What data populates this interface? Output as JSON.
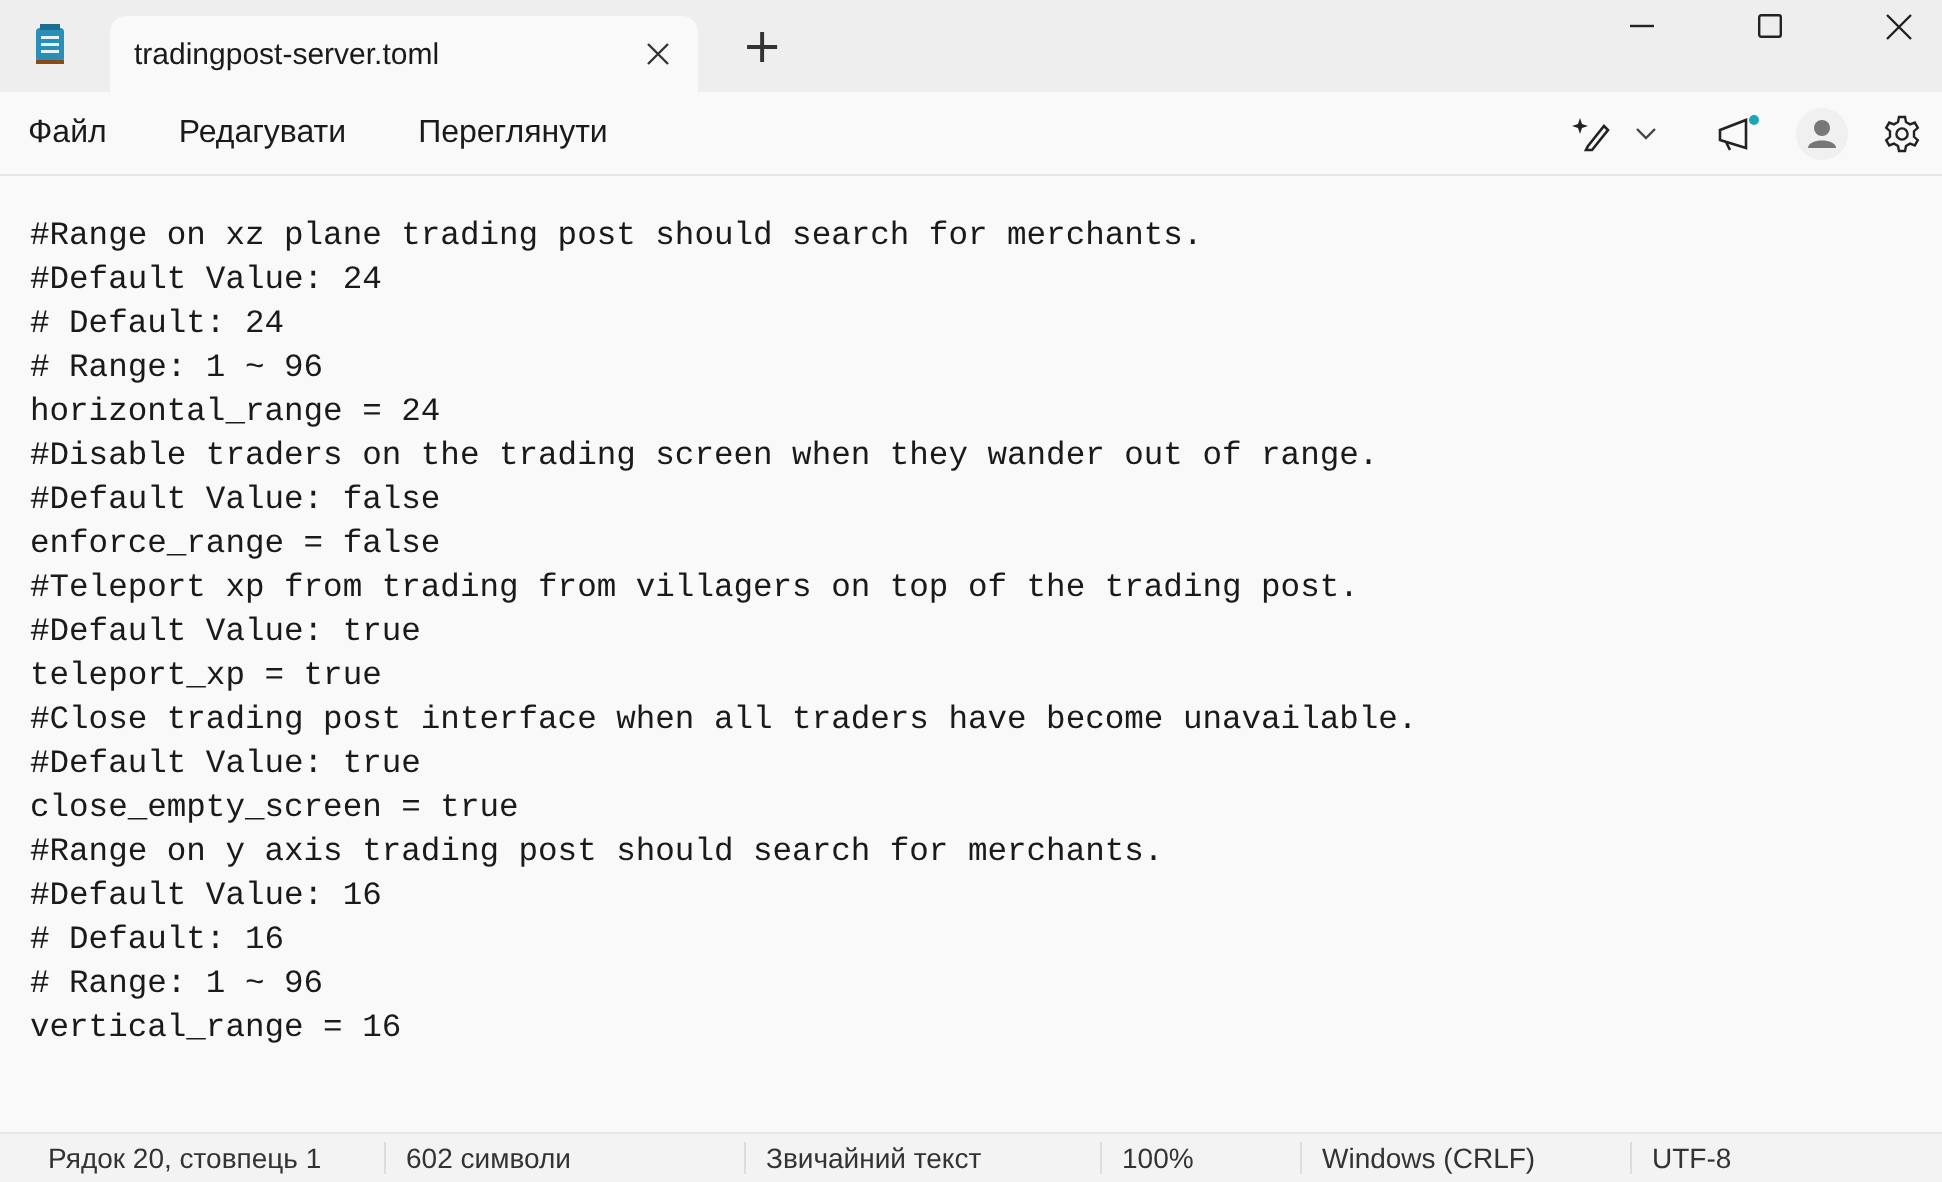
{
  "window": {
    "tab": {
      "title": "tradingpost-server.toml",
      "selected": true
    },
    "new_tab": "+"
  },
  "menu": [
    "Файл",
    "Редагувати",
    "Переглянути"
  ],
  "toolbar": {
    "notification_dot": true
  },
  "editor": {
    "lines": [
      "#Range on xz plane trading post should search for merchants.",
      "#Default Value: 24",
      "# Default: 24",
      "# Range: 1 ~ 96",
      "horizontal_range = 24",
      "#Disable traders on the trading screen when they wander out of range.",
      "#Default Value: false",
      "enforce_range = false",
      "#Teleport xp from trading from villagers on top of the trading post.",
      "#Default Value: true",
      "teleport_xp = true",
      "#Close trading post interface when all traders have become unavailable.",
      "#Default Value: true",
      "close_empty_screen = true",
      "#Range on y axis trading post should search for merchants.",
      "#Default Value: 16",
      "# Default: 16",
      "# Range: 1 ~ 96",
      "vertical_range = 16"
    ]
  },
  "status_bar": [
    "Рядок 20, стовпець 1",
    "602 символи",
    "Звичайний текст",
    "100%",
    "Windows (CRLF)",
    "UTF-8"
  ]
}
